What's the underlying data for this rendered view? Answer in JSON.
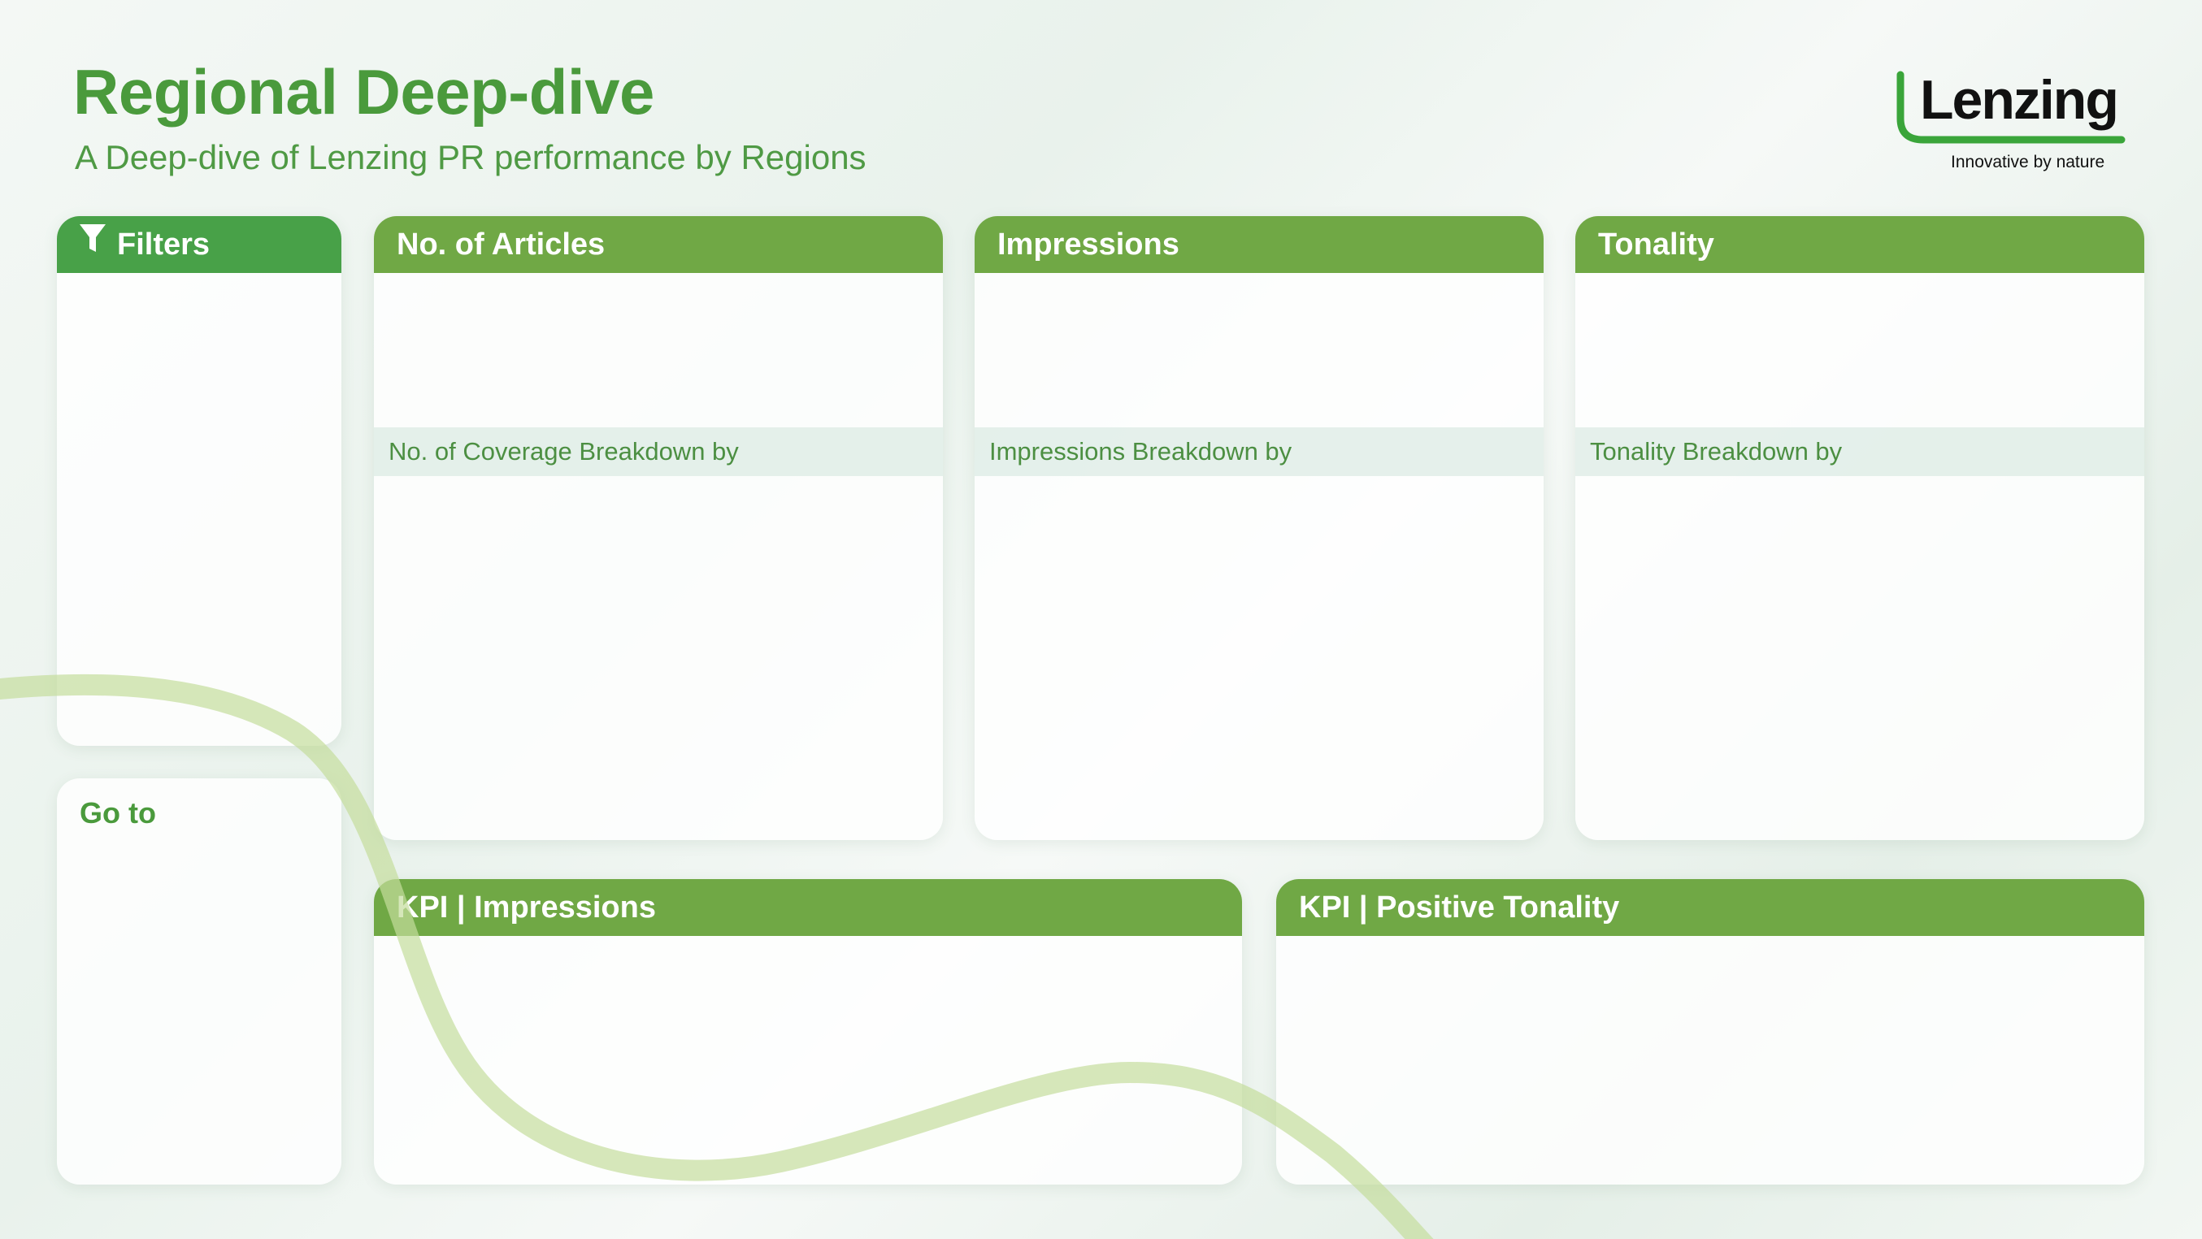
{
  "header": {
    "title": "Regional Deep-dive",
    "subtitle": "A Deep-dive of Lenzing PR performance by Regions"
  },
  "logo": {
    "wordmark": "Lenzing",
    "tagline": "Innovative by nature"
  },
  "filters": {
    "label": "Filters",
    "icon": "filter-icon"
  },
  "goto": {
    "label": "Go to"
  },
  "cards": {
    "articles": {
      "title": "No. of Articles",
      "breakdown": "No. of Coverage Breakdown by"
    },
    "impressions": {
      "title": "Impressions",
      "breakdown": "Impressions Breakdown by"
    },
    "tonality": {
      "title": "Tonality",
      "breakdown": "Tonality Breakdown by"
    },
    "kpi_impressions": {
      "title": "KPI | Impressions"
    },
    "kpi_tonality": {
      "title": "KPI | Positive Tonality"
    }
  },
  "colors": {
    "brand_green": "#4a9a3c",
    "header_green": "#70a845",
    "filter_header_green": "#48a148",
    "wave_green": "#c9dfa7"
  }
}
